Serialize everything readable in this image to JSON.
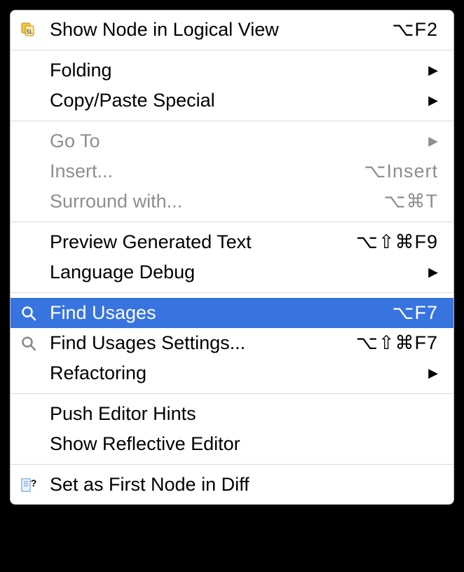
{
  "menu": {
    "items": [
      {
        "label": "Show Node in Logical View",
        "shortcut": "⌥F2",
        "icon": "logical-view-icon",
        "disabled": false,
        "selected": false,
        "submenu": false
      },
      {
        "separator": true
      },
      {
        "label": "Folding",
        "shortcut": "",
        "icon": "",
        "disabled": false,
        "selected": false,
        "submenu": true
      },
      {
        "label": "Copy/Paste Special",
        "shortcut": "",
        "icon": "",
        "disabled": false,
        "selected": false,
        "submenu": true
      },
      {
        "separator": true
      },
      {
        "label": "Go To",
        "shortcut": "",
        "icon": "",
        "disabled": true,
        "selected": false,
        "submenu": true
      },
      {
        "label": "Insert...",
        "shortcut": "⌥Insert",
        "icon": "",
        "disabled": true,
        "selected": false,
        "submenu": false
      },
      {
        "label": "Surround with...",
        "shortcut": "⌥⌘T",
        "icon": "",
        "disabled": true,
        "selected": false,
        "submenu": false
      },
      {
        "separator": true
      },
      {
        "label": "Preview Generated Text",
        "shortcut": "⌥⇧⌘F9",
        "icon": "",
        "disabled": false,
        "selected": false,
        "submenu": false
      },
      {
        "label": "Language Debug",
        "shortcut": "",
        "icon": "",
        "disabled": false,
        "selected": false,
        "submenu": true
      },
      {
        "separator": true
      },
      {
        "label": "Find Usages",
        "shortcut": "⌥F7",
        "icon": "search-icon",
        "disabled": false,
        "selected": true,
        "submenu": false
      },
      {
        "label": "Find Usages Settings...",
        "shortcut": "⌥⇧⌘F7",
        "icon": "search-icon-dim",
        "disabled": false,
        "selected": false,
        "submenu": false
      },
      {
        "label": "Refactoring",
        "shortcut": "",
        "icon": "",
        "disabled": false,
        "selected": false,
        "submenu": true
      },
      {
        "separator": true
      },
      {
        "label": "Push Editor Hints",
        "shortcut": "",
        "icon": "",
        "disabled": false,
        "selected": false,
        "submenu": false
      },
      {
        "label": "Show Reflective Editor",
        "shortcut": "",
        "icon": "",
        "disabled": false,
        "selected": false,
        "submenu": false
      },
      {
        "separator": true
      },
      {
        "label": "Set as First Node in Diff",
        "shortcut": "",
        "icon": "diff-node-icon",
        "disabled": false,
        "selected": false,
        "submenu": false
      }
    ]
  }
}
